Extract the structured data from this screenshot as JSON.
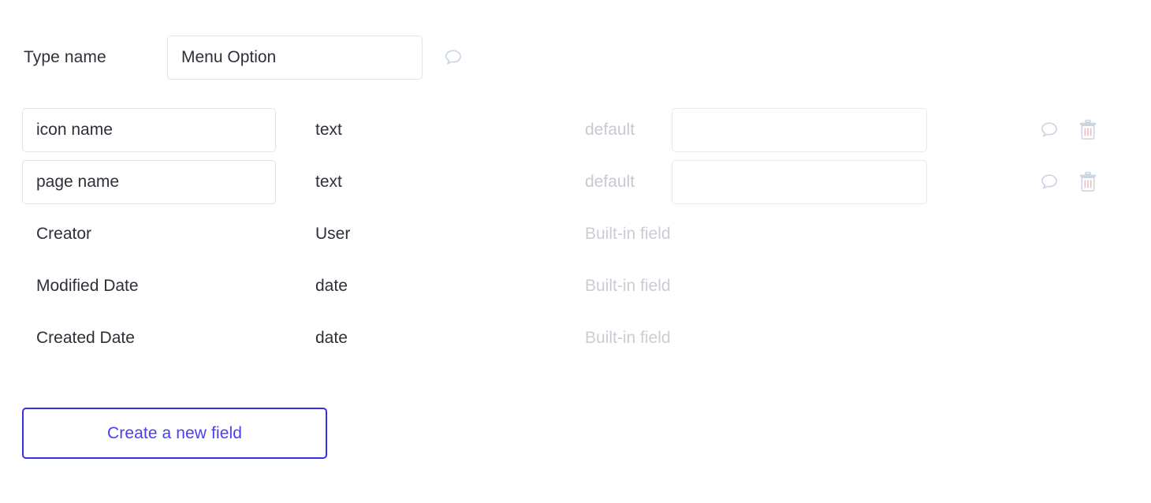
{
  "type_name_row": {
    "label": "Type name",
    "value": "Menu Option",
    "placeholder": "Type name",
    "comment_icon": "comment-bubble-icon"
  },
  "columns": {
    "default_label": "default",
    "builtin_label": "Built-in field"
  },
  "fields": [
    {
      "name": "icon name",
      "name_placeholder": "field name",
      "type": "text",
      "editable": true,
      "default_value": "",
      "default_placeholder": "",
      "default_label": "default",
      "comment_icon": "comment-bubble-icon",
      "delete_icon": "trash-icon"
    },
    {
      "name": "page name",
      "name_placeholder": "field name",
      "type": "text",
      "editable": true,
      "default_value": "",
      "default_placeholder": "",
      "default_label": "default",
      "comment_icon": "comment-bubble-icon",
      "delete_icon": "trash-icon"
    },
    {
      "name": "Creator",
      "type": "User",
      "editable": false,
      "builtin_label": "Built-in field"
    },
    {
      "name": "Modified Date",
      "type": "date",
      "editable": false,
      "builtin_label": "Built-in field"
    },
    {
      "name": "Created Date",
      "type": "date",
      "editable": false,
      "builtin_label": "Built-in field"
    }
  ],
  "create_button": {
    "label": "Create a new field"
  },
  "colors": {
    "accent": "#3b2ee8",
    "accent_text": "#4a3ff0",
    "text": "#2f2f38",
    "muted": "#c8cbd2",
    "icon": "#cdd6e2",
    "border": "#e2e4e8",
    "background": "#ffffff"
  }
}
